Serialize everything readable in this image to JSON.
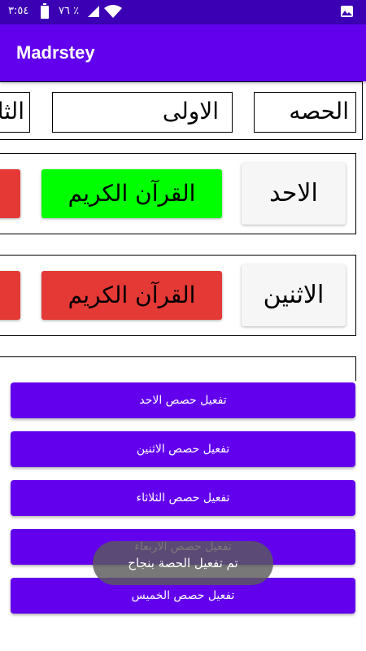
{
  "status_bar": {
    "time": "٣:٥٤",
    "battery": "٧٦ ٪",
    "icons": [
      "battery-icon",
      "signal-icon",
      "wifi-icon",
      "gallery-icon"
    ]
  },
  "app_bar": {
    "title": "Madrstey"
  },
  "periods": {
    "header": "الحصه",
    "first": "الاولى",
    "second_partial": "الثا"
  },
  "days": [
    {
      "day": "الاحد",
      "subject": "القرآن الكريم",
      "subject_color": "#00ff00"
    },
    {
      "day": "الاثنين",
      "subject": "القرآن الكريم",
      "subject_color": "#e53935"
    }
  ],
  "actions": [
    "تفعيل حصص الاحد",
    "تفعيل حصص الاثنين",
    "تفعيل حصص الثلاثاء",
    "تفعيل حصص الاربعاء",
    "تفعيل حصص الخميس"
  ],
  "toast": "تم تفعيل الحصة بنجاح",
  "colors": {
    "primary": "#6200ee",
    "status_bar": "#3b00b3",
    "active_subject": "#00ff00",
    "inactive_subject": "#e53935"
  }
}
